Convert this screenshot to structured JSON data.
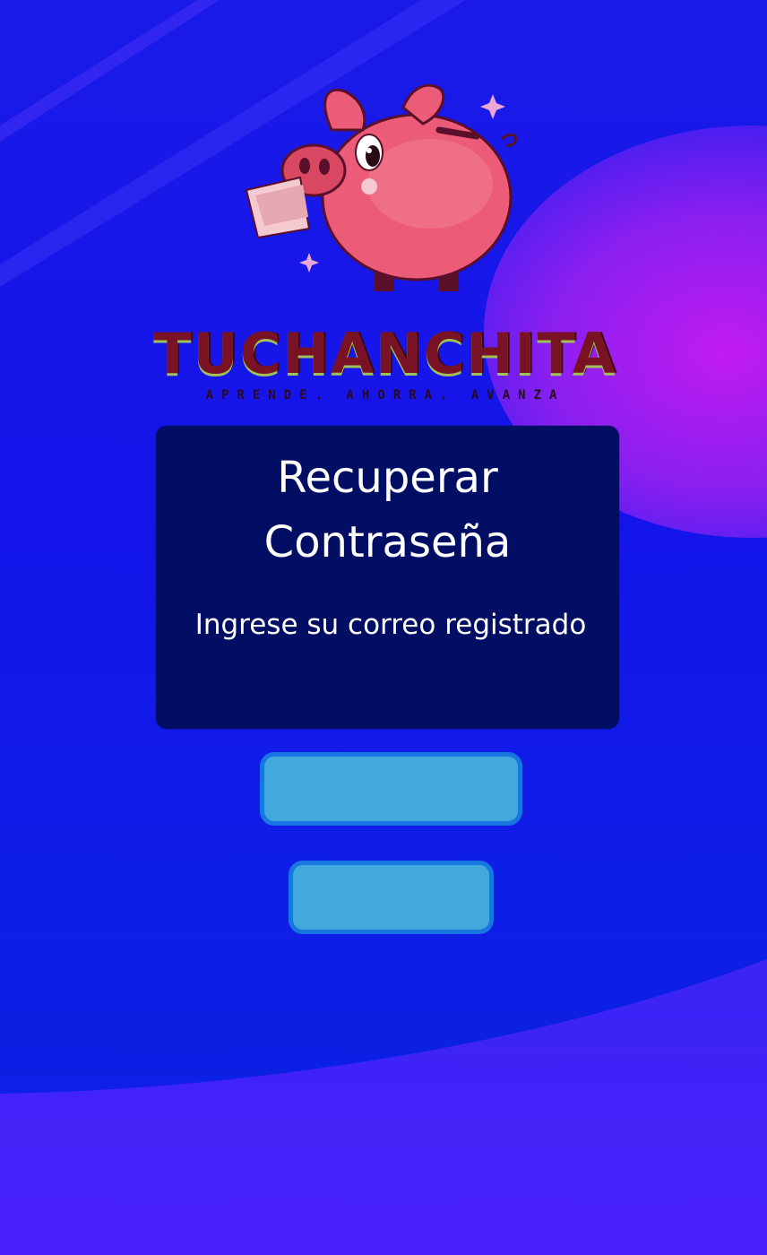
{
  "brand": {
    "name": "TUCHANCHITA",
    "tagline": "APRENDE. AHORRA. AVANZA"
  },
  "card": {
    "title": "Recuperar\nContraseña",
    "subtitle": "Ingrese su correo registrado"
  },
  "buttons": {
    "primary_label": "",
    "secondary_label": ""
  },
  "colors": {
    "background": "#1414ea",
    "card": "#010e63",
    "button_fill": "#42a9dc",
    "button_border": "#1677e0",
    "brand_text": "#7a1226",
    "orb": "#a21df0"
  },
  "icons": [
    "piggy-bank-logo",
    "sparkle-icon"
  ]
}
